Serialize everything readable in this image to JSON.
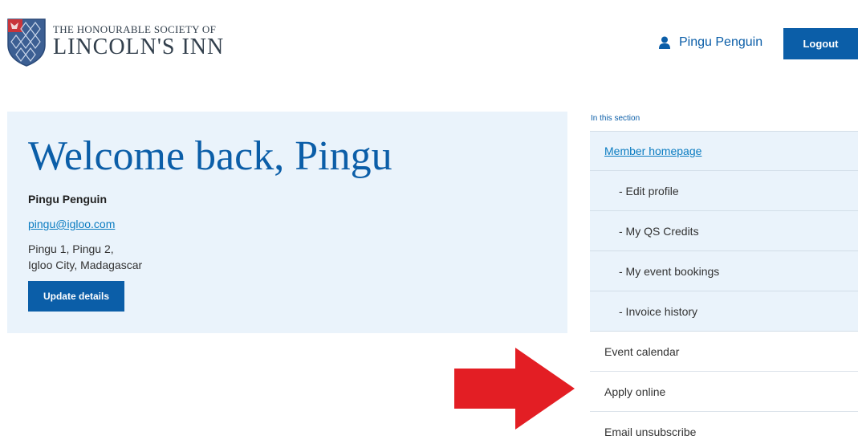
{
  "header": {
    "logo_line1": "THE HONOURABLE SOCIETY OF",
    "logo_line2": "LINCOLN'S INN",
    "user_name": "Pingu Penguin",
    "logout_label": "Logout"
  },
  "profile": {
    "welcome": "Welcome back, Pingu",
    "name": "Pingu Penguin",
    "email": "pingu@igloo.com",
    "address_line1": "Pingu 1, Pingu 2,",
    "address_line2": "Igloo City, Madagascar",
    "update_label": "Update details"
  },
  "section_nav": {
    "title": "In this section",
    "items": [
      {
        "label": "Member homepage"
      },
      {
        "label": "- Edit profile"
      },
      {
        "label": "- My QS Credits"
      },
      {
        "label": "- My event bookings"
      },
      {
        "label": "- Invoice history"
      },
      {
        "label": "Event calendar"
      },
      {
        "label": "Apply online"
      },
      {
        "label": "Email unsubscribe"
      }
    ]
  },
  "colors": {
    "brand_blue": "#0b5ea8",
    "panel_bg": "#eaf3fb",
    "arrow_red": "#e31e24"
  }
}
